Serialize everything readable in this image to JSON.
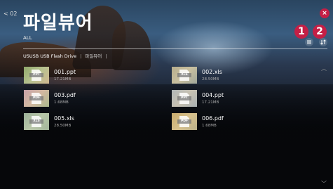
{
  "header": {
    "back_label": "< 02",
    "title": "파일뷰어",
    "filter": "ALL",
    "close_symbol": "×"
  },
  "callouts": [
    "1",
    "2"
  ],
  "breadcrumb": {
    "device": "USUSB USB Flash Drive",
    "separator": "|",
    "folder": "파일뷰어",
    "trailing": "|"
  },
  "files": [
    {
      "name": "001.ppt",
      "size": "17.21MB",
      "type": "PPT"
    },
    {
      "name": "002.xls",
      "size": "28.50MB",
      "type": "XLS"
    },
    {
      "name": "003.pdf",
      "size": "1.68MB",
      "type": "PDF"
    },
    {
      "name": "004.ppt",
      "size": "17.21MB",
      "type": "PPT"
    },
    {
      "name": "005.xls",
      "size": "28.50MB",
      "type": "XLS"
    },
    {
      "name": "006.pdf",
      "size": "1.68MB",
      "type": "PDF"
    }
  ],
  "scroll": {
    "up": "︿",
    "down": "﹀"
  },
  "colors": {
    "accent": "#c41f46"
  }
}
